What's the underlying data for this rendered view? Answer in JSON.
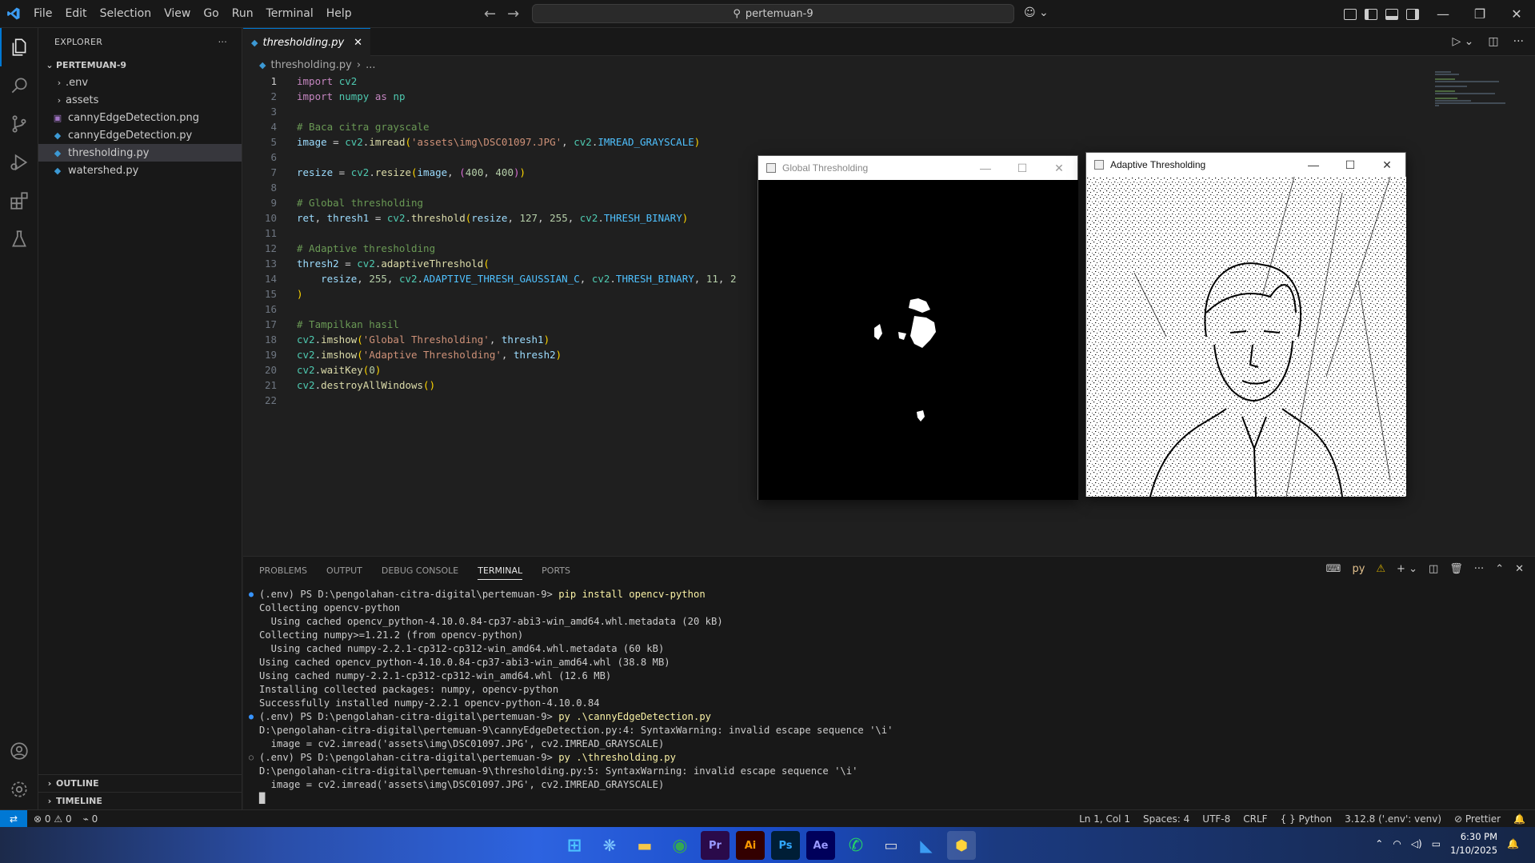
{
  "titlebar": {
    "menu": [
      "File",
      "Edit",
      "Selection",
      "View",
      "Go",
      "Run",
      "Terminal",
      "Help"
    ],
    "search_text": "pertemuan-9"
  },
  "sidebar": {
    "title": "EXPLORER",
    "root": "PERTEMUAN-9",
    "items": [
      {
        "label": ".env",
        "type": "folder"
      },
      {
        "label": "assets",
        "type": "folder"
      },
      {
        "label": "cannyEdgeDetection.png",
        "type": "image"
      },
      {
        "label": "cannyEdgeDetection.py",
        "type": "python"
      },
      {
        "label": "thresholding.py",
        "type": "python"
      },
      {
        "label": "watershed.py",
        "type": "python"
      }
    ],
    "outline": "OUTLINE",
    "timeline": "TIMELINE"
  },
  "editor": {
    "tab_label": "thresholding.py",
    "breadcrumb_file": "thresholding.py",
    "breadcrumb_more": "...",
    "line_numbers": [
      "1",
      "2",
      "3",
      "4",
      "5",
      "6",
      "7",
      "8",
      "9",
      "10",
      "11",
      "12",
      "13",
      "14",
      "15",
      "16",
      "17",
      "18",
      "19",
      "20",
      "21",
      "22"
    ]
  },
  "windows": {
    "global_title": "Global Thresholding",
    "adaptive_title": "Adaptive Thresholding"
  },
  "panel": {
    "tabs": [
      "PROBLEMS",
      "OUTPUT",
      "DEBUG CONSOLE",
      "TERMINAL",
      "PORTS"
    ],
    "shell_label": "py",
    "terminal": [
      {
        "dot": "blue",
        "prompt": "(.env) PS D:\\pengolahan-citra-digital\\pertemuan-9> ",
        "cmd": "pip install opencv-python"
      },
      {
        "text": "Collecting opencv-python"
      },
      {
        "text": "  Using cached opencv_python-4.10.0.84-cp37-abi3-win_amd64.whl.metadata (20 kB)"
      },
      {
        "text": "Collecting numpy>=1.21.2 (from opencv-python)"
      },
      {
        "text": "  Using cached numpy-2.2.1-cp312-cp312-win_amd64.whl.metadata (60 kB)"
      },
      {
        "text": "Using cached opencv_python-4.10.0.84-cp37-abi3-win_amd64.whl (38.8 MB)"
      },
      {
        "text": "Using cached numpy-2.2.1-cp312-cp312-win_amd64.whl (12.6 MB)"
      },
      {
        "text": "Installing collected packages: numpy, opencv-python"
      },
      {
        "text": "Successfully installed numpy-2.2.1 opencv-python-4.10.0.84"
      },
      {
        "dot": "blue",
        "prompt": "(.env) PS D:\\pengolahan-citra-digital\\pertemuan-9> ",
        "cmd": "py .\\cannyEdgeDetection.py"
      },
      {
        "text": "D:\\pengolahan-citra-digital\\pertemuan-9\\cannyEdgeDetection.py:4: SyntaxWarning: invalid escape sequence '\\i'"
      },
      {
        "text": "  image = cv2.imread('assets\\img\\DSC01097.JPG', cv2.IMREAD_GRAYSCALE)"
      },
      {
        "dot": "hollow",
        "prompt": "(.env) PS D:\\pengolahan-citra-digital\\pertemuan-9> ",
        "cmd": "py .\\thresholding.py"
      },
      {
        "text": "D:\\pengolahan-citra-digital\\pertemuan-9\\thresholding.py:5: SyntaxWarning: invalid escape sequence '\\i'"
      },
      {
        "text": "  image = cv2.imread('assets\\img\\DSC01097.JPG', cv2.IMREAD_GRAYSCALE)"
      },
      {
        "text": "█"
      }
    ]
  },
  "statusbar": {
    "errors": "0",
    "warnings": "0",
    "ports": "0",
    "position": "Ln 1, Col 1",
    "spaces": "Spaces: 4",
    "encoding": "UTF-8",
    "eol": "CRLF",
    "language": "Python",
    "interpreter": "3.12.8 ('.env': venv)",
    "formatter": "Prettier"
  },
  "taskbar": {
    "time": "6:30 PM",
    "date": "1/10/2025",
    "apps": [
      "Pr",
      "Ai",
      "Ps",
      "Ae"
    ]
  },
  "colors": {
    "accent": "#0078d4",
    "keyword": "#c586c0",
    "string": "#ce9178",
    "comment": "#6a9955"
  }
}
